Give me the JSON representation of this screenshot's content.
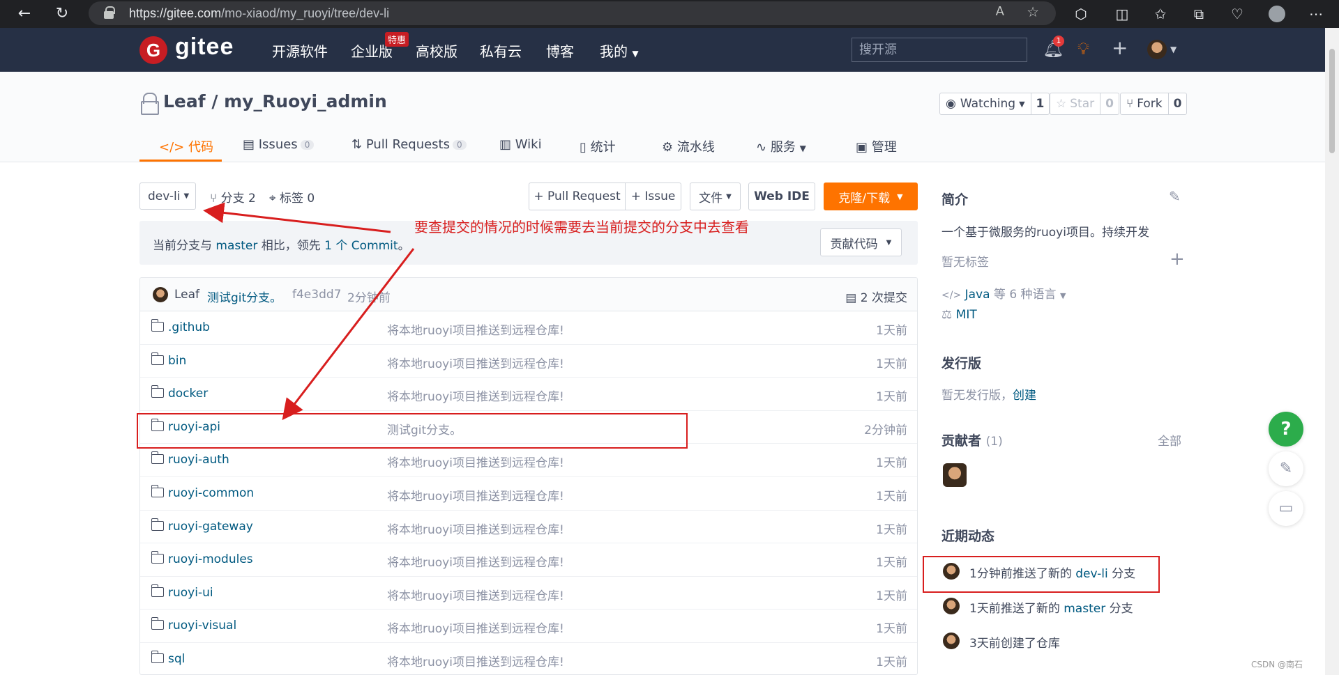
{
  "browser": {
    "url_host": "https://gitee.com",
    "url_path": "/mo-xiaod/my_ruoyi/tree/dev-li"
  },
  "header": {
    "logo_text": "gitee",
    "nav": [
      "开源软件",
      "企业版",
      "高校版",
      "私有云",
      "博客",
      "我的"
    ],
    "hot_badge": "特惠",
    "search_placeholder": "搜开源",
    "bell_count": "1"
  },
  "repo": {
    "title": "Leaf / my_Ruoyi_admin",
    "watch_label": "Watching",
    "watch_count": "1",
    "star_label": "Star",
    "star_count": "0",
    "fork_label": "Fork",
    "fork_count": "0",
    "tabs": [
      {
        "label": "代码",
        "icon": "code-icon"
      },
      {
        "label": "Issues",
        "badge": "0"
      },
      {
        "label": "Pull Requests",
        "badge": "0"
      },
      {
        "label": "Wiki"
      },
      {
        "label": "统计"
      },
      {
        "label": "流水线"
      },
      {
        "label": "服务"
      },
      {
        "label": "管理"
      }
    ]
  },
  "toolbar": {
    "branch": "dev-li",
    "branches": "分支 2",
    "tags": "标签 0",
    "pull_request": "+ Pull Request",
    "issue": "+ Issue",
    "file": "文件",
    "web_ide": "Web IDE",
    "clone": "克隆/下载"
  },
  "notice": {
    "prefix": "当前分支与",
    "branch": "master",
    "mid": "相比，领先",
    "count": "1 个 Commit",
    "suffix": "。",
    "contribute": "贡献代码"
  },
  "commit": {
    "author": "Leaf",
    "message": "测试git分支。",
    "hash": "f4e3dd7",
    "time": "2分钟前",
    "total": "2 次提交"
  },
  "files": [
    {
      "name": ".github",
      "msg": "将本地ruoyi项目推送到远程仓库!",
      "time": "1天前"
    },
    {
      "name": "bin",
      "msg": "将本地ruoyi项目推送到远程仓库!",
      "time": "1天前"
    },
    {
      "name": "docker",
      "msg": "将本地ruoyi项目推送到远程仓库!",
      "time": "1天前"
    },
    {
      "name": "ruoyi-api",
      "msg": "测试git分支。",
      "time": "2分钟前"
    },
    {
      "name": "ruoyi-auth",
      "msg": "将本地ruoyi项目推送到远程仓库!",
      "time": "1天前"
    },
    {
      "name": "ruoyi-common",
      "msg": "将本地ruoyi项目推送到远程仓库!",
      "time": "1天前"
    },
    {
      "name": "ruoyi-gateway",
      "msg": "将本地ruoyi项目推送到远程仓库!",
      "time": "1天前"
    },
    {
      "name": "ruoyi-modules",
      "msg": "将本地ruoyi项目推送到远程仓库!",
      "time": "1天前"
    },
    {
      "name": "ruoyi-ui",
      "msg": "将本地ruoyi项目推送到远程仓库!",
      "time": "1天前"
    },
    {
      "name": "ruoyi-visual",
      "msg": "将本地ruoyi项目推送到远程仓库!",
      "time": "1天前"
    },
    {
      "name": "sql",
      "msg": "将本地ruoyi项目推送到远程仓库!",
      "time": "1天前"
    }
  ],
  "sidebar": {
    "intro_title": "简介",
    "intro_text": "一个基于微服务的ruoyi项目。持续开发",
    "no_tags": "暂无标签",
    "language_name": "Java",
    "language_rest": "等 6 种语言",
    "license": "MIT",
    "release_title": "发行版",
    "release_text": "暂无发行版，",
    "release_create": "创建",
    "contrib_title": "贡献者",
    "contrib_count": "(1)",
    "contrib_all": "全部",
    "activity_title": "近期动态",
    "activities": [
      {
        "pre": "1分钟前推送了新的",
        "link": "dev-li",
        "post": "分支"
      },
      {
        "pre": "1天前推送了新的",
        "link": "master",
        "post": "分支"
      },
      {
        "pre": "3天前创建了仓库",
        "link": "",
        "post": ""
      }
    ]
  },
  "annotation": {
    "text": "要查提交的情况的时候需要去当前提交的分支中去查看",
    "color": "#d81e1e"
  },
  "watermark": "CSDN @南石",
  "colors": {
    "header_bg": "#263045",
    "accent": "#fe7300",
    "link": "#005980",
    "brand_red": "#c71d23",
    "help_green": "#2cac4b"
  }
}
